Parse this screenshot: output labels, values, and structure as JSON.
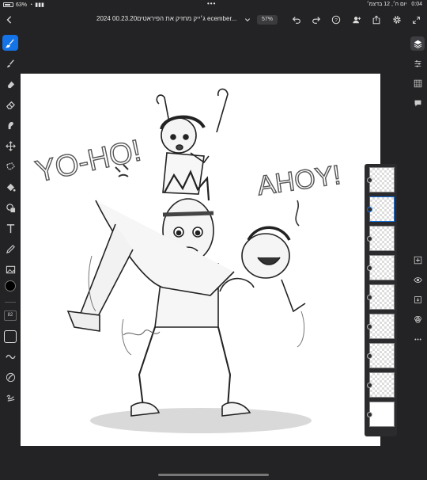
{
  "status_bar": {
    "time": "0:04",
    "date": "יום ה׳, 12 בדצמ׳",
    "battery": "63%",
    "more_dots": "•••"
  },
  "toolbar": {
    "document_title": "ג׳ייק מחזיק את הפיראטים00.23.20 2024 ecember...",
    "zoom": "57%"
  },
  "tools": {
    "brush_size": "82"
  },
  "canvas_text": {
    "yo_ho": "YO-HO!",
    "ahoy": "AHOY!"
  },
  "layers": {
    "count": 9,
    "selected_index": 1
  },
  "colors": {
    "accent": "#1473e6",
    "app_background": "#232325",
    "current_color": "#000000"
  },
  "icons": {
    "left_rail": [
      "brush-icon",
      "smudge-icon",
      "eraser-fill-icon",
      "eraser-icon",
      "liquify-icon",
      "transform-icon",
      "lasso-icon",
      "fill-icon",
      "shape-icon",
      "text-icon",
      "eyedropper-icon",
      "image-icon"
    ],
    "right_rail": [
      "layers-icon",
      "adjustments-icon",
      "grid-icon",
      "comments-icon"
    ]
  }
}
